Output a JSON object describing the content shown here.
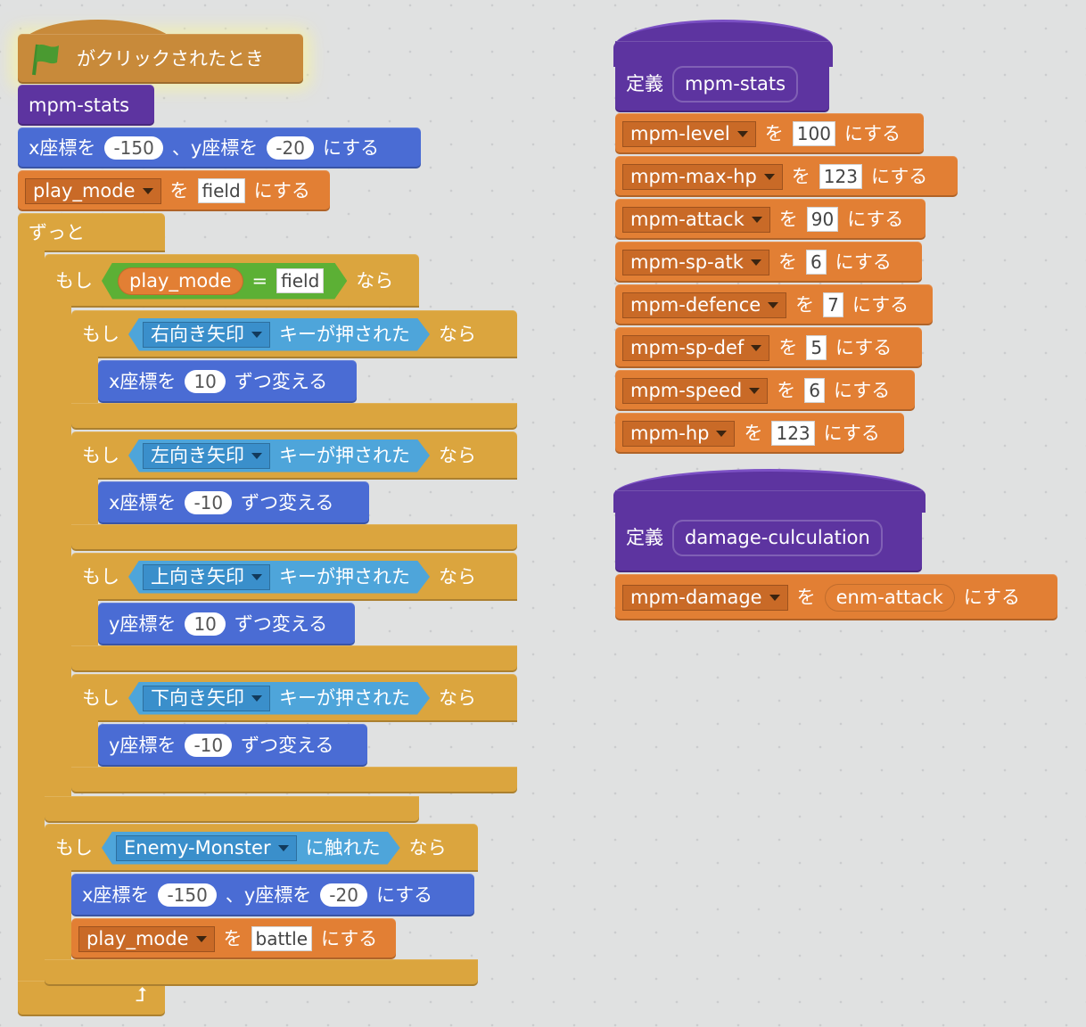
{
  "main_script": {
    "hat": {
      "label": "がクリックされたとき",
      "icon": "green-flag-icon"
    },
    "call_stats": "mpm-stats",
    "goto1": {
      "x_label": "x座標を",
      "x": "-150",
      "sep": "、y座標を",
      "y": "-20",
      "suffix": "にする"
    },
    "set_mode1": {
      "var": "play_mode",
      "wo": "を",
      "value": "field",
      "suffix": "にする"
    },
    "forever": {
      "label": "ずっと",
      "icon": "loop-arrow-icon"
    },
    "if_mode": {
      "if": "もし",
      "var": "play_mode",
      "eq": "=",
      "value": "field",
      "then": "なら"
    },
    "key_ifs": [
      {
        "if": "もし",
        "key": "右向き矢印",
        "pressed": "キーが押された",
        "then": "なら",
        "action": "x座標を",
        "amount": "10",
        "suffix": "ずつ変える"
      },
      {
        "if": "もし",
        "key": "左向き矢印",
        "pressed": "キーが押された",
        "then": "なら",
        "action": "x座標を",
        "amount": "-10",
        "suffix": "ずつ変える"
      },
      {
        "if": "もし",
        "key": "上向き矢印",
        "pressed": "キーが押された",
        "then": "なら",
        "action": "y座標を",
        "amount": "10",
        "suffix": "ずつ変える"
      },
      {
        "if": "もし",
        "key": "下向き矢印",
        "pressed": "キーが押された",
        "then": "なら",
        "action": "y座標を",
        "amount": "-10",
        "suffix": "ずつ変える"
      }
    ],
    "if_touch": {
      "if": "もし",
      "sprite": "Enemy-Monster",
      "touched": "に触れた",
      "then": "なら"
    },
    "goto2": {
      "x_label": "x座標を",
      "x": "-150",
      "sep": "、y座標を",
      "y": "-20",
      "suffix": "にする"
    },
    "set_mode2": {
      "var": "play_mode",
      "wo": "を",
      "value": "battle",
      "suffix": "にする"
    }
  },
  "define_stats": {
    "define": "定義",
    "name": "mpm-stats",
    "sets": [
      {
        "var": "mpm-level",
        "wo": "を",
        "value": "100",
        "suffix": "にする"
      },
      {
        "var": "mpm-max-hp",
        "wo": "を",
        "value": "123",
        "suffix": "にする"
      },
      {
        "var": "mpm-attack",
        "wo": "を",
        "value": "90",
        "suffix": "にする"
      },
      {
        "var": "mpm-sp-atk",
        "wo": "を",
        "value": "6",
        "suffix": "にする"
      },
      {
        "var": "mpm-defence",
        "wo": "を",
        "value": "7",
        "suffix": "にする"
      },
      {
        "var": "mpm-sp-def",
        "wo": "を",
        "value": "5",
        "suffix": "にする"
      },
      {
        "var": "mpm-speed",
        "wo": "を",
        "value": "6",
        "suffix": "にする"
      },
      {
        "var": "mpm-hp",
        "wo": "を",
        "value": "123",
        "suffix": "にする"
      }
    ]
  },
  "define_damage": {
    "define": "定義",
    "name": "damage-culculation",
    "set": {
      "var": "mpm-damage",
      "wo": "を",
      "value": "enm-attack",
      "suffix": "にする"
    }
  }
}
